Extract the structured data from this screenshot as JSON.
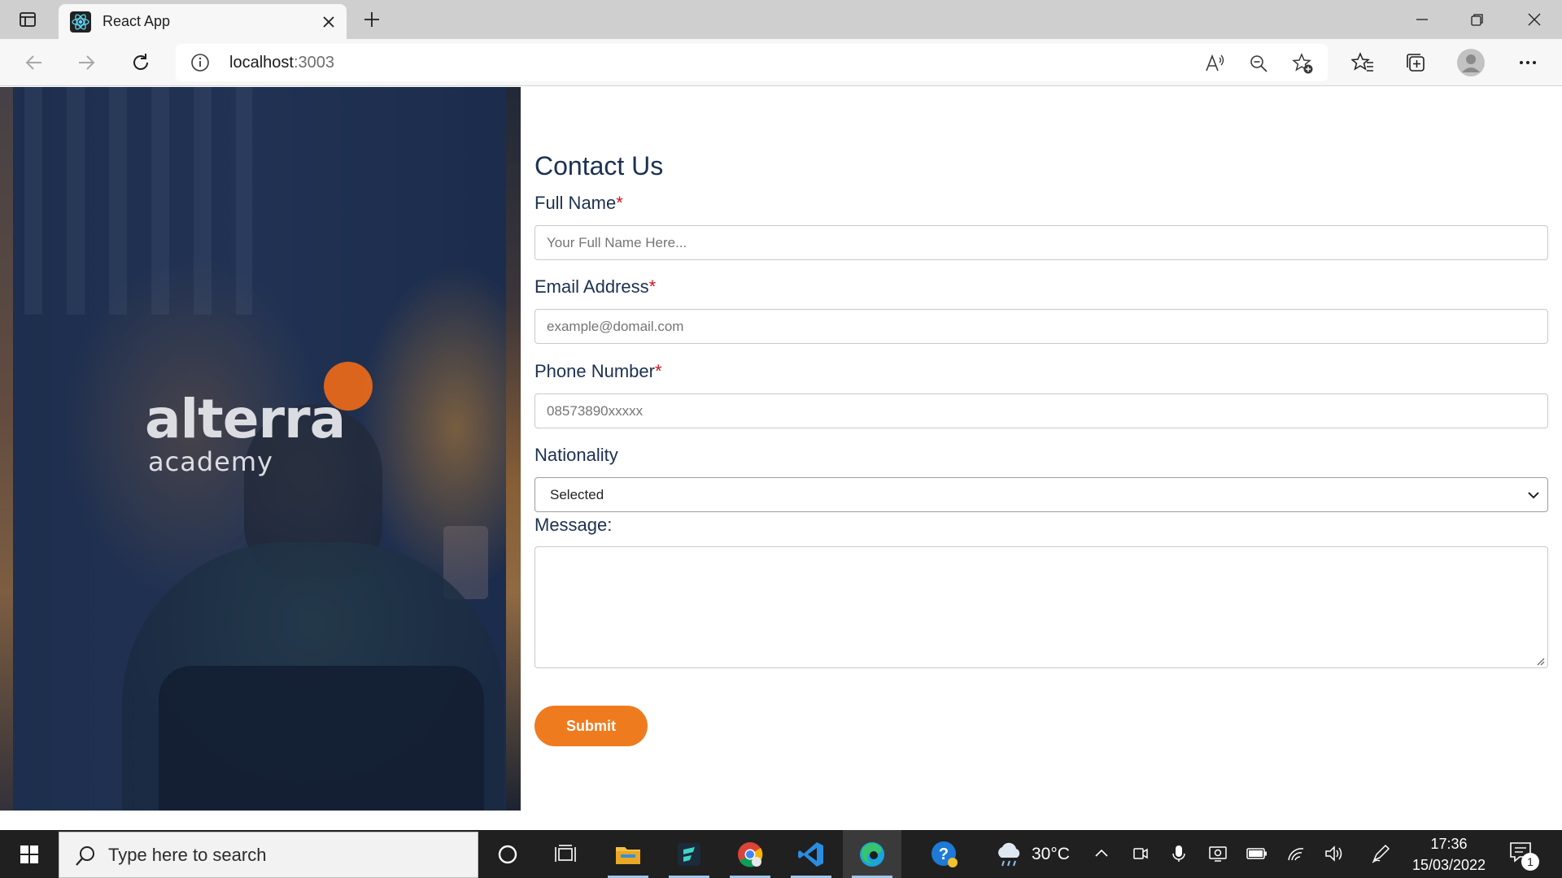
{
  "browser": {
    "tab": {
      "title": "React App"
    },
    "address": {
      "host": "localhost",
      "port": ":3003"
    },
    "colors": {
      "tab_strip": "#cfcfcf",
      "toolbar": "#f7f7f7"
    }
  },
  "hero": {
    "logo_main": "alterra",
    "logo_sub": "academy",
    "colors": {
      "overlay": "#1f3050",
      "logo_dot": "#ec6a19"
    }
  },
  "form": {
    "title": "Contact Us",
    "required_mark": "*",
    "fields": {
      "full_name": {
        "label": "Full Name",
        "placeholder": "Your Full Name Here..."
      },
      "email": {
        "label": "Email Address",
        "placeholder": "example@domail.com"
      },
      "phone": {
        "label": "Phone Number",
        "placeholder": "08573890xxxxx"
      },
      "nationality": {
        "label": "Nationality",
        "selected": "Selected"
      },
      "message": {
        "label": "Message:"
      }
    },
    "submit_label": "Submit",
    "colors": {
      "text": "#1c3150",
      "required": "#d0141b",
      "button": "#ef7b1f"
    }
  },
  "taskbar": {
    "search_placeholder": "Type here to search",
    "weather": {
      "temp": "30°C",
      "icon": "rain-cloud-icon"
    },
    "clock": {
      "time": "17:36",
      "date": "15/03/2022"
    },
    "notification_count": "1",
    "apps": [
      "file-explorer-icon",
      "filmora-icon",
      "chrome-icon",
      "vscode-icon",
      "edge-icon",
      "help-icon"
    ]
  }
}
